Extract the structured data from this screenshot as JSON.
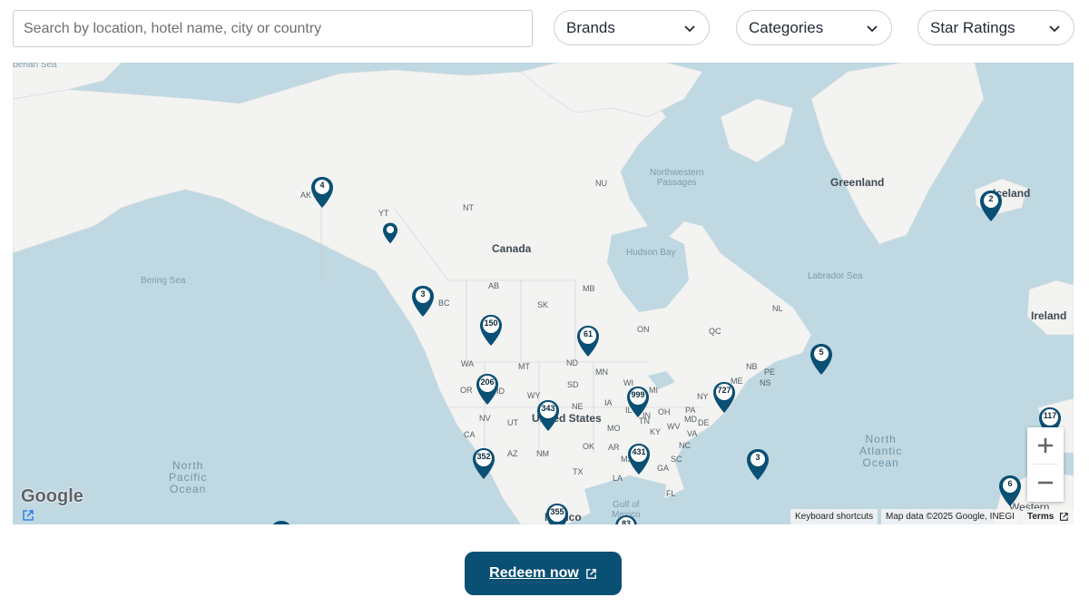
{
  "search": {
    "placeholder": "Search by location, hotel name, city or country",
    "value": ""
  },
  "filters": {
    "brands": "Brands",
    "categories": "Categories",
    "star_ratings": "Star Ratings"
  },
  "map": {
    "oceans": [
      {
        "id": "north-pacific",
        "text": "North\nPacific\nOcean"
      },
      {
        "id": "north-atlantic",
        "text": "North\nAtlantic\nOcean"
      }
    ],
    "seas": [
      {
        "id": "siberian",
        "text": "iberian Sea"
      },
      {
        "id": "bering",
        "text": "Bering Sea"
      },
      {
        "id": "labrador",
        "text": "Labrador Sea"
      }
    ],
    "features": [
      {
        "id": "nw-passages",
        "text": "Northwestern\nPassages"
      },
      {
        "id": "hudson-bay",
        "text": "Hudson Bay"
      },
      {
        "id": "gulf-mexico",
        "text": "Gulf of\nMexico"
      }
    ],
    "countries": [
      {
        "id": "canada",
        "text": "Canada"
      },
      {
        "id": "greenland",
        "text": "Greenland"
      },
      {
        "id": "iceland",
        "text": "Iceland"
      },
      {
        "id": "ireland",
        "text": "Ireland"
      },
      {
        "id": "united-states",
        "text": "United States"
      },
      {
        "id": "mexico",
        "text": "Mexico"
      },
      {
        "id": "western-sahara",
        "text": "Western"
      }
    ],
    "regions": [
      {
        "id": "AK",
        "text": "AK"
      },
      {
        "id": "YT",
        "text": "YT"
      },
      {
        "id": "NT",
        "text": "NT"
      },
      {
        "id": "NU",
        "text": "NU"
      },
      {
        "id": "BC",
        "text": "BC"
      },
      {
        "id": "AB",
        "text": "AB"
      },
      {
        "id": "SK",
        "text": "SK"
      },
      {
        "id": "MB",
        "text": "MB"
      },
      {
        "id": "ON",
        "text": "ON"
      },
      {
        "id": "QC",
        "text": "QC"
      },
      {
        "id": "NL",
        "text": "NL"
      },
      {
        "id": "NB",
        "text": "NB"
      },
      {
        "id": "PE",
        "text": "PE"
      },
      {
        "id": "NS",
        "text": "NS"
      },
      {
        "id": "WA",
        "text": "WA"
      },
      {
        "id": "OR",
        "text": "OR"
      },
      {
        "id": "ID",
        "text": "ID"
      },
      {
        "id": "MT",
        "text": "MT"
      },
      {
        "id": "ND",
        "text": "ND"
      },
      {
        "id": "MN",
        "text": "MN"
      },
      {
        "id": "SD",
        "text": "SD"
      },
      {
        "id": "WY",
        "text": "WY"
      },
      {
        "id": "WI",
        "text": "WI"
      },
      {
        "id": "MI",
        "text": "MI"
      },
      {
        "id": "NY",
        "text": "NY"
      },
      {
        "id": "ME",
        "text": "ME"
      },
      {
        "id": "NE",
        "text": "NE"
      },
      {
        "id": "IA",
        "text": "IA"
      },
      {
        "id": "IL",
        "text": "IL"
      },
      {
        "id": "IN",
        "text": "IN"
      },
      {
        "id": "OH",
        "text": "OH"
      },
      {
        "id": "PA",
        "text": "PA"
      },
      {
        "id": "NV",
        "text": "NV"
      },
      {
        "id": "UT",
        "text": "UT"
      },
      {
        "id": "CA",
        "text": "CA"
      },
      {
        "id": "MO",
        "text": "MO"
      },
      {
        "id": "KY",
        "text": "KY"
      },
      {
        "id": "WV",
        "text": "WV"
      },
      {
        "id": "VA",
        "text": "VA"
      },
      {
        "id": "MD",
        "text": "MD"
      },
      {
        "id": "DE",
        "text": "DE"
      },
      {
        "id": "AZ",
        "text": "AZ"
      },
      {
        "id": "NM",
        "text": "NM"
      },
      {
        "id": "OK",
        "text": "OK"
      },
      {
        "id": "AR",
        "text": "AR"
      },
      {
        "id": "NC",
        "text": "NC"
      },
      {
        "id": "SC",
        "text": "SC"
      },
      {
        "id": "TX",
        "text": "TX"
      },
      {
        "id": "GA",
        "text": "GA"
      },
      {
        "id": "LA",
        "text": "LA"
      },
      {
        "id": "FL",
        "text": "FL"
      },
      {
        "id": "TN",
        "text": "TN"
      },
      {
        "id": "MS",
        "text": "MS"
      }
    ],
    "markers": [
      {
        "id": "alaska",
        "count": "4"
      },
      {
        "id": "yukon",
        "count": ""
      },
      {
        "id": "vancouver",
        "count": "3"
      },
      {
        "id": "alberta",
        "count": "150"
      },
      {
        "id": "manitoba",
        "count": "61"
      },
      {
        "id": "nova-scotia",
        "count": "5"
      },
      {
        "id": "iceland",
        "count": "2"
      },
      {
        "id": "pacific-nw",
        "count": "206"
      },
      {
        "id": "mountain",
        "count": "343"
      },
      {
        "id": "great-lakes",
        "count": "999"
      },
      {
        "id": "northeast",
        "count": "727"
      },
      {
        "id": "southwest",
        "count": "352"
      },
      {
        "id": "southeast",
        "count": "431"
      },
      {
        "id": "bermuda",
        "count": "3"
      },
      {
        "id": "mexico",
        "count": "355"
      },
      {
        "id": "caribbean",
        "count": "83"
      },
      {
        "id": "portugal",
        "count": "117"
      },
      {
        "id": "canary",
        "count": "6"
      },
      {
        "id": "hawaii",
        "count": ""
      }
    ],
    "google_logo": "Google",
    "keyboard_shortcuts": "Keyboard shortcuts",
    "map_data": "Map data ©2025 Google, INEGI",
    "terms": "Terms"
  },
  "redeem": {
    "label": "Redeem now"
  },
  "colors": {
    "accent": "#0a4f74",
    "pin": "#0a4f74",
    "water": "#bfd8e2",
    "land": "#f3f3f1"
  }
}
